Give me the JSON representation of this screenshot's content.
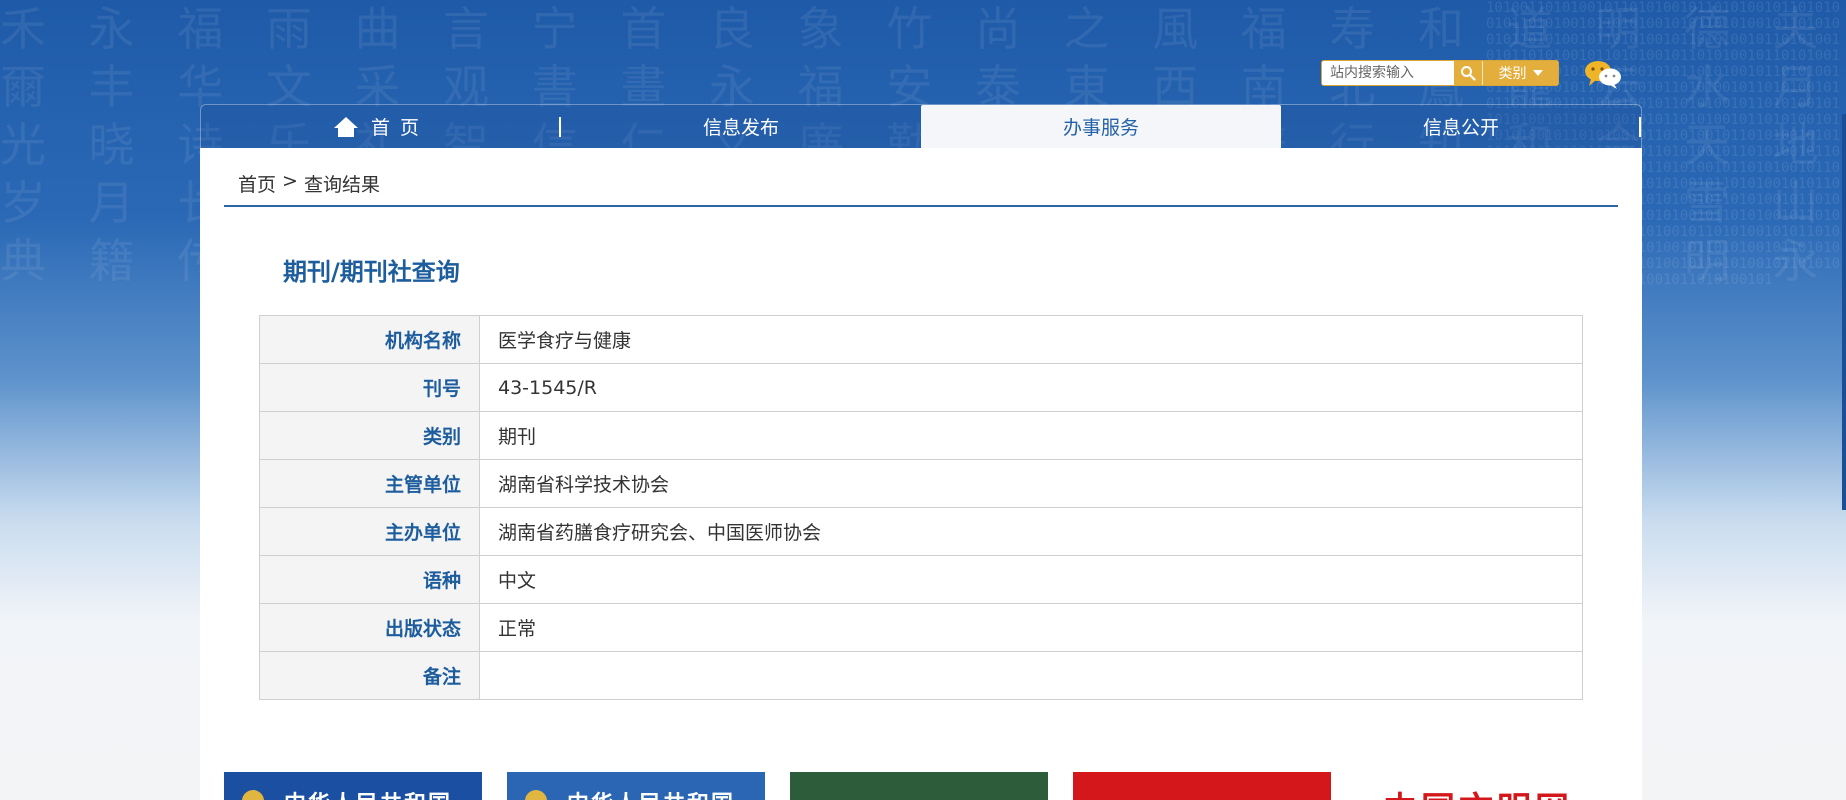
{
  "header": {
    "search": {
      "placeholder": "站内搜索输入",
      "category_label": "类别"
    }
  },
  "nav": {
    "items": [
      {
        "label": "首页",
        "icon": "home-icon"
      },
      {
        "label": "信息发布"
      },
      {
        "label": "办事服务",
        "active": true
      },
      {
        "label": "信息公开"
      }
    ]
  },
  "breadcrumb": {
    "home": "首页",
    "separator": ">",
    "current": "查询结果"
  },
  "page_title": "期刊/期刊社查询",
  "details": [
    {
      "label": "机构名称",
      "value": "医学食疗与健康"
    },
    {
      "label": "刊号",
      "value": "43-1545/R"
    },
    {
      "label": "类别",
      "value": "期刊"
    },
    {
      "label": "主管单位",
      "value": "湖南省科学技术协会"
    },
    {
      "label": "主办单位",
      "value": "湖南省药膳食疗研究会、中国医师协会"
    },
    {
      "label": "语种",
      "value": "中文"
    },
    {
      "label": "出版状态",
      "value": "正常"
    },
    {
      "label": "备注",
      "value": ""
    }
  ],
  "banners": {
    "b1": "中华人民共和国",
    "b2": "中华人民共和国",
    "b5": "中国文明网"
  },
  "colors": {
    "brand_blue": "#1d5d9d",
    "accent_gold": "#e3ae3b",
    "nav_active_bg": "#f4f6f9"
  }
}
